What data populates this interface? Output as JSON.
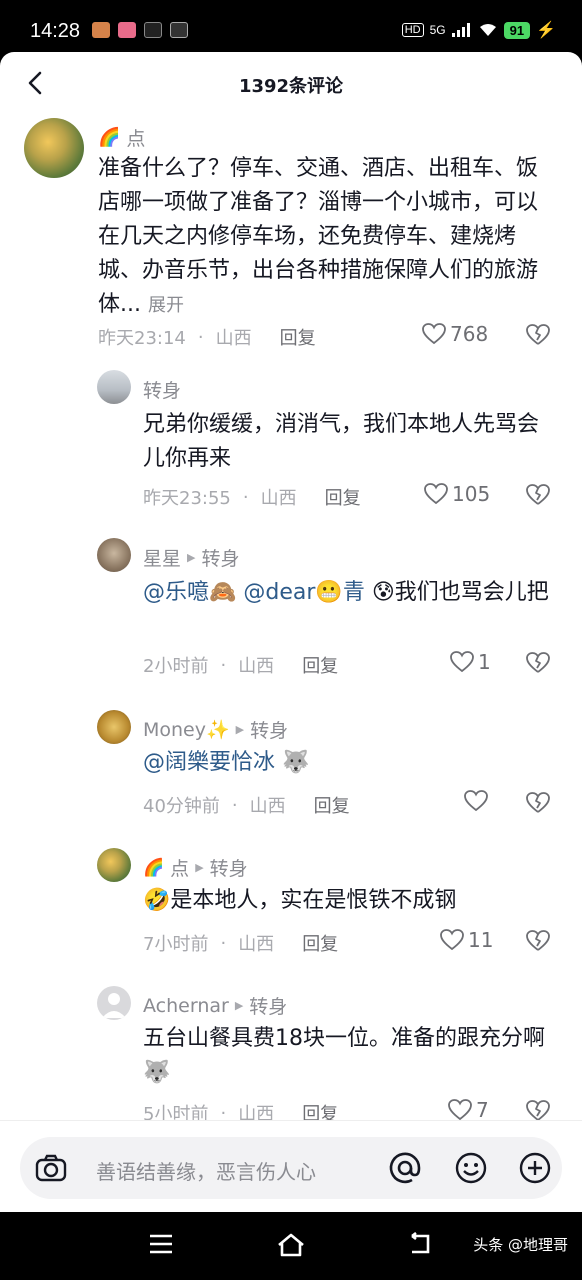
{
  "status_bar": {
    "time": "14:28",
    "network": "5G",
    "battery": "91"
  },
  "header": {
    "title": "1392条评论"
  },
  "comments": [
    {
      "name": "点",
      "text": "准备什么了？停车、交通、酒店、出租车、饭店哪一项做了准备了？淄博一个小城市，可以在几天之内修停车场，还免费停车、建烧烤城、办音乐节，出台各种措施保障人们的旅游体...",
      "more": "展开",
      "time": "昨天23:14",
      "location": "山西",
      "reply": "回复",
      "likes": "768"
    },
    {
      "name": "转身",
      "text": "兄弟你缓缓，消消气，我们本地人先骂会儿你再来",
      "time": "昨天23:55",
      "location": "山西",
      "reply": "回复",
      "likes": "105"
    },
    {
      "name": "星星",
      "reply_to": "转身",
      "mention1": "@乐噫🙈",
      "mention2": "@dear😬青",
      "text": "😰我们也骂会儿把",
      "time": "2小时前",
      "location": "山西",
      "reply": "回复",
      "likes": "1"
    },
    {
      "name": "Money✨",
      "reply_to": "转身",
      "mention1": "@阔樂要恰冰",
      "text": "🐺",
      "time": "40分钟前",
      "location": "山西",
      "reply": "回复",
      "likes": ""
    },
    {
      "name": "点",
      "reply_to": "转身",
      "text": "🤣是本地人，实在是恨铁不成钢",
      "time": "7小时前",
      "location": "山西",
      "reply": "回复",
      "likes": "11"
    },
    {
      "name": "Achernar",
      "reply_to": "转身",
      "text": "五台山餐具费18块一位。准备的跟充分啊🐺",
      "time": "5小时前",
      "location": "山西",
      "reply": "回复",
      "likes": "7"
    }
  ],
  "input": {
    "placeholder": "善语结善缘，恶言伤人心"
  },
  "watermark": "头条 @地理哥",
  "colors": {
    "accent_link": "#2e5b8a",
    "secondary_text": "#8a8b91"
  }
}
